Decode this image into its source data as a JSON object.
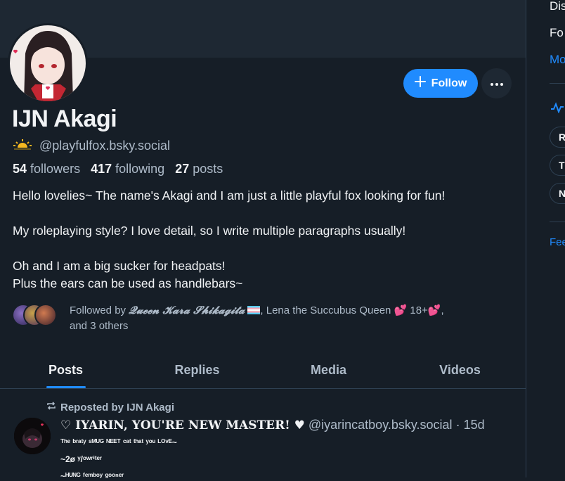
{
  "profile": {
    "display_name": "IJN Akagi",
    "handle": "@playfulfox.bsky.social",
    "followers_count": "54",
    "followers_label": "followers",
    "following_count": "417",
    "following_label": "following",
    "posts_count": "27",
    "posts_label": "posts",
    "follow_button": "Follow",
    "bio": [
      "Hello lovelies~ The name's Akagi and I am just a little playful fox looking for fun!",
      "",
      "My roleplaying style? I love detail, so I write multiple paragraphs usually!",
      "",
      "Oh and I am a big sucker for headpats!",
      "Plus the ears can be used as handlebars~"
    ],
    "followed_by": {
      "prefix": "Followed by ",
      "name1": "𝓠𝓾𝓮𝓮𝓷 𝓚𝓪𝓻𝓪 𝓢𝓱𝓲𝓴𝓪𝓰𝓲𝓽𝓪",
      "name2": ", Lena the Succubus Queen 💕 18+💕,",
      "suffix": "and 3 others"
    }
  },
  "tabs": [
    {
      "label": "Posts",
      "active": true
    },
    {
      "label": "Replies",
      "active": false
    },
    {
      "label": "Media",
      "active": false
    },
    {
      "label": "Videos",
      "active": false
    }
  ],
  "feed": {
    "repost_label": "Reposted by IJN Akagi",
    "post": {
      "author_name": "♡ IYARIN, YOU'RE NEW MASTER! ♥",
      "author_handle": "@iyarincatboy.bsky.social",
      "time": "· 15d",
      "line1": "ᵀʰᵉ ᵇʳᵃᵗʸ ˢᴹᵁᴳ ᴺᴱᴱᵀ ᶜᵃᵗ ᵗʰᵃᵗ ʸᵒᵘ ᴸᴼᵛᴱ~",
      "line2": "~2ø ʸ/ᵒʷʳⁱᵗᵉʳ",
      "line3": "~ᴴᵁᴺᴳ ᶠᵉᵐᵇᵒʸ ᵍᵒᵒⁿᵉʳ"
    }
  },
  "sidebar": {
    "item1": "Dis",
    "item2": "Fo",
    "more": "Mo",
    "pill1": "R",
    "pill2": "T",
    "pill3": "N",
    "feed_link": "Fee"
  },
  "colors": {
    "accent": "#208bfe",
    "background": "#161e27",
    "banner": "#1e2833",
    "muted_text": "#aebbc9"
  }
}
